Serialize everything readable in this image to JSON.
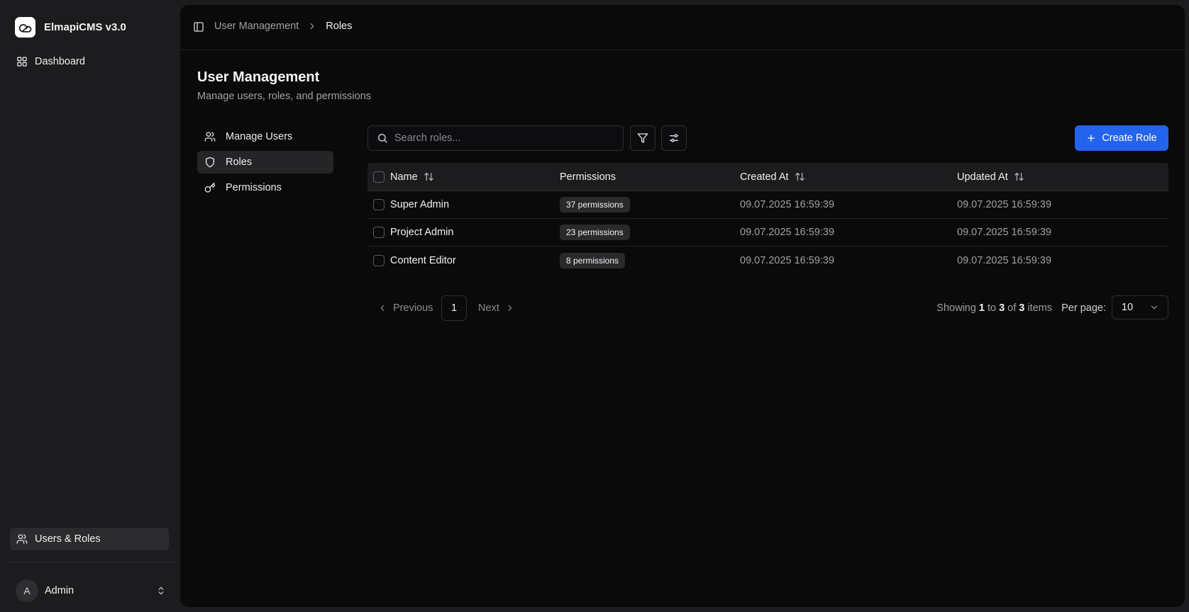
{
  "app": {
    "name": "ElmapiCMS v3.0"
  },
  "sidebar": {
    "items": [
      {
        "label": "Dashboard"
      },
      {
        "label": "Users & Roles"
      }
    ],
    "user": {
      "initial": "A",
      "name": "Admin"
    }
  },
  "breadcrumb": {
    "parent": "User Management",
    "current": "Roles"
  },
  "page": {
    "title": "User Management",
    "subtitle": "Manage users, roles, and permissions"
  },
  "subnav": {
    "items": [
      {
        "label": "Manage Users"
      },
      {
        "label": "Roles"
      },
      {
        "label": "Permissions"
      }
    ]
  },
  "search": {
    "placeholder": "Search roles...",
    "value": ""
  },
  "toolbar": {
    "create_label": "Create Role"
  },
  "table": {
    "headers": {
      "name": "Name",
      "permissions": "Permissions",
      "created": "Created At",
      "updated": "Updated At"
    },
    "rows": [
      {
        "name": "Super Admin",
        "permissions": "37 permissions",
        "created": "09.07.2025 16:59:39",
        "updated": "09.07.2025 16:59:39"
      },
      {
        "name": "Project Admin",
        "permissions": "23 permissions",
        "created": "09.07.2025 16:59:39",
        "updated": "09.07.2025 16:59:39"
      },
      {
        "name": "Content Editor",
        "permissions": "8 permissions",
        "created": "09.07.2025 16:59:39",
        "updated": "09.07.2025 16:59:39"
      }
    ]
  },
  "pagination": {
    "previous": "Previous",
    "next": "Next",
    "page": "1",
    "showing_prefix": "Showing",
    "from": "1",
    "to_word": "to",
    "to": "3",
    "of_word": "of",
    "total": "3",
    "items_word": "items",
    "per_page_label": "Per page:",
    "per_page_value": "10"
  },
  "colors": {
    "accent": "#2463eb",
    "background": "#0a0a0b",
    "sidebar": "#1c1c1e"
  }
}
